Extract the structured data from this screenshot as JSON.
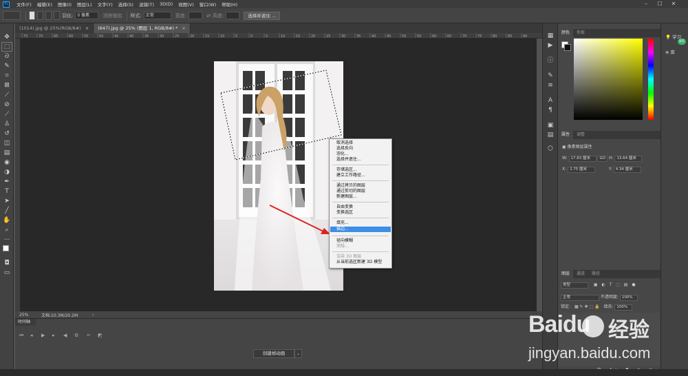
{
  "menubar": {
    "app_logo": "Ps",
    "items": [
      "文件(F)",
      "编辑(E)",
      "图像(I)",
      "图层(L)",
      "文字(Y)",
      "选择(S)",
      "滤镜(T)",
      "3D(D)",
      "视图(V)",
      "窗口(W)",
      "帮助(H)"
    ],
    "minimize": "–",
    "maximize": "☐",
    "close": "✕"
  },
  "options": {
    "feather_label": "羽化:",
    "feather_value": "0 像素",
    "antialias_label": "消除锯齿",
    "style_label": "样式:",
    "style_value": "正常",
    "width_label": "宽度:",
    "height_label": "高度:",
    "select_mask_button": "选择并遮住 ..."
  },
  "tabs": [
    {
      "label": "(1014).jpg @ 25%(RGB/8#)",
      "close": "×"
    },
    {
      "label": "(647).jpg @ 25% (图层 1, RGB/8#) *",
      "close": "×"
    }
  ],
  "ruler_marks": [
    "75",
    "70",
    "65",
    "60",
    "55",
    "50",
    "45",
    "40",
    "35",
    "30",
    "25",
    "20",
    "15",
    "10",
    "5",
    "0",
    "5",
    "10",
    "15",
    "20",
    "25",
    "30",
    "35",
    "40",
    "45",
    "50",
    "55",
    "60",
    "65",
    "70",
    "75",
    "80",
    "85",
    "90"
  ],
  "status": {
    "zoom": "25%",
    "doc_info": "文档:10.3M/20.2M",
    "arrow": "›"
  },
  "timeline": {
    "tab": "时间轴",
    "create_button": "创建帧动画",
    "dropdown": "⌄"
  },
  "context_menu": {
    "items": [
      "取消选择",
      "选择反向",
      "羽化...",
      "选择并遮住...",
      "存储选区...",
      "建立工作路径...",
      "通过拷贝的图层",
      "通过剪切的图层",
      "新建图层...",
      "自由变换",
      "变换选区",
      "填充...",
      "描边...",
      "径向模糊",
      "渐隐...",
      "渲染 3D 图层",
      "从当前选区新建 3D 模型"
    ],
    "highlighted": "描边..."
  },
  "panels": {
    "color_tab": "颜色",
    "swatches_tab": "色板",
    "properties_tab": "属性",
    "adjustments_tab": "调整",
    "pixel_layer_props": "像素图层属性",
    "w_label": "W:",
    "w_value": "17.83 厘米",
    "h_label": "H:",
    "h_value": "13.64 厘米",
    "link": "GO",
    "x_label": "X:",
    "x_value": "2.75 厘米",
    "y_label": "Y:",
    "y_value": "4.34 厘米",
    "layers_tab": "图层",
    "channels_tab": "通道",
    "paths_tab": "路径",
    "kind": "类型",
    "blend": "正常",
    "opacity_label": "不透明度:",
    "opacity_value": "100%",
    "lock_label": "锁定:",
    "fill_label": "填充:",
    "fill_value": "100%"
  },
  "far_right": {
    "learn": "学习",
    "libraries": "库",
    "badge": "K/S"
  },
  "watermark": {
    "brand": "Baidu",
    "cn": "经验",
    "url": "jingyan.baidu.com"
  },
  "colors": {
    "accent": "#3d8ee6",
    "arrow": "#e02020"
  }
}
